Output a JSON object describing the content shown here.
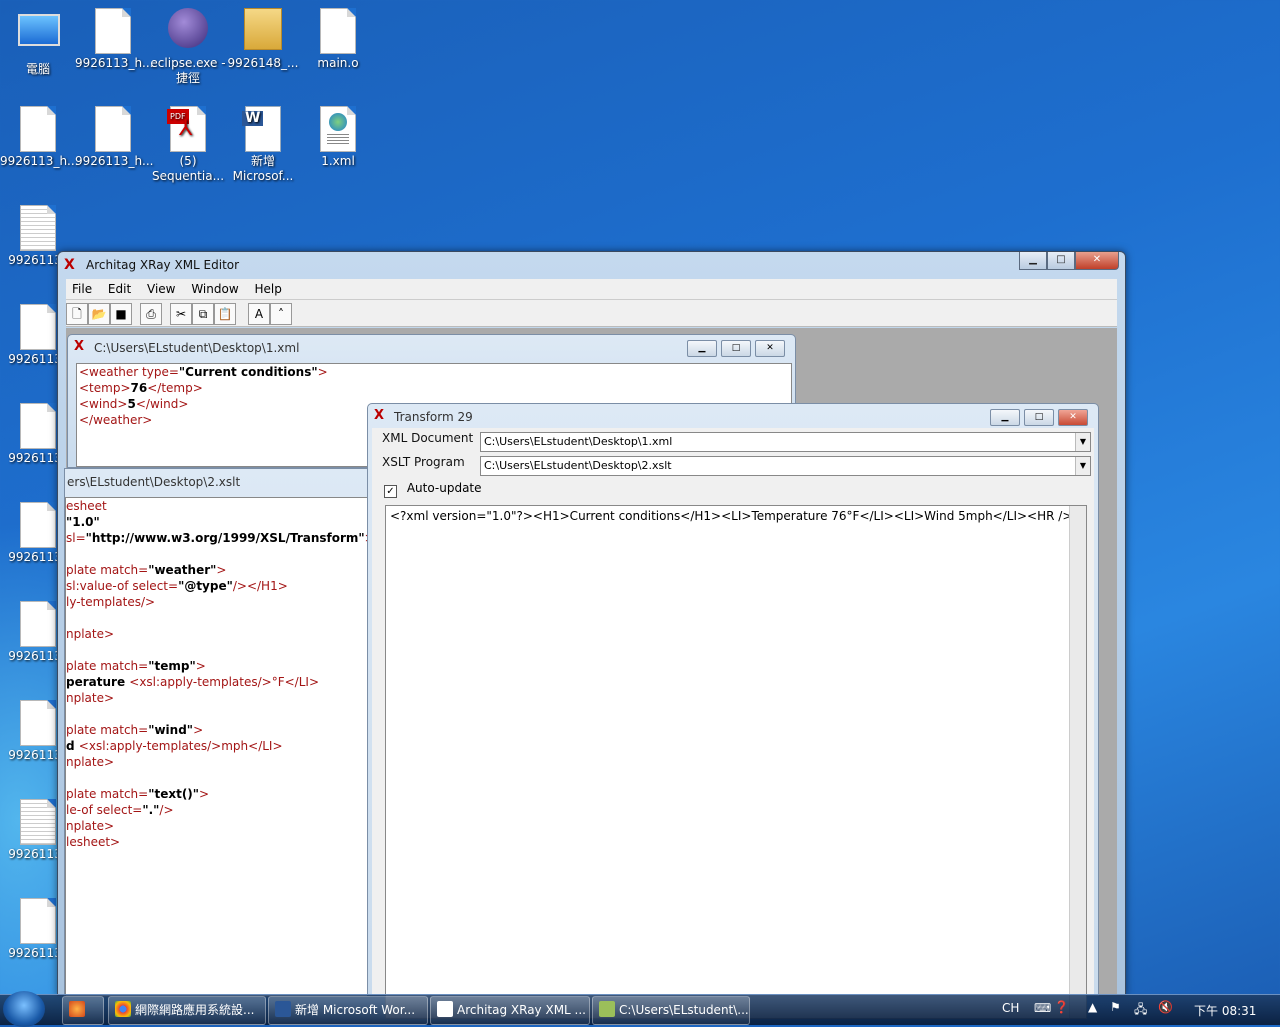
{
  "desktop": {
    "icons": [
      {
        "label": "電腦",
        "icon": "computer-icon"
      },
      {
        "label": "9926113_h...",
        "icon": "document-icon"
      },
      {
        "label": "eclipse.exe - 捷徑",
        "icon": "eclipse-icon"
      },
      {
        "label": "9926148_...",
        "icon": "folder-icon"
      },
      {
        "label": "main.o",
        "icon": "file-icon"
      },
      {
        "label": "9926113_h...",
        "icon": "file-icon"
      },
      {
        "label": "9926113_h...",
        "icon": "file-icon"
      },
      {
        "label": "(5) Sequentia...",
        "icon": "pdf-icon"
      },
      {
        "label": "新增 Microsof...",
        "icon": "word-icon"
      },
      {
        "label": "1.xml",
        "icon": "xml-icon"
      },
      {
        "label": "9926113_",
        "icon": "text-icon"
      },
      {
        "label": "9926113_",
        "icon": "file-icon"
      },
      {
        "label": "9926113_",
        "icon": "document-icon"
      },
      {
        "label": "9926113_",
        "icon": "file-icon"
      },
      {
        "label": "9926113_",
        "icon": "file-icon"
      },
      {
        "label": "9926113_",
        "icon": "file-icon"
      },
      {
        "label": "9926113_",
        "icon": "text-icon"
      },
      {
        "label": "9926113_",
        "icon": "file-icon"
      }
    ]
  },
  "app": {
    "title": "Architag XRay XML Editor",
    "menu": [
      "File",
      "Edit",
      "View",
      "Window",
      "Help"
    ],
    "toolbar": [
      "new-icon",
      "open-icon",
      "save-icon",
      "print-icon",
      "cut-icon",
      "copy-icon",
      "paste-icon",
      "font-icon",
      "format-icon"
    ]
  },
  "xml_window": {
    "title": "C:\\Users\\ELstudent\\Desktop\\1.xml",
    "lines": [
      {
        "pre": "<weather type=",
        "val": "\"Current conditions\"",
        "post": ">"
      },
      {
        "pre": "<temp>",
        "val": "76",
        "post": "</temp>"
      },
      {
        "pre": "<wind>",
        "val": "5",
        "post": "</wind>"
      },
      {
        "pre": "</weather>",
        "val": "",
        "post": ""
      }
    ]
  },
  "xslt_window": {
    "title": "ers\\ELstudent\\Desktop\\2.xslt",
    "lines": [
      {
        "pre": "esheet",
        "val": "",
        "post": ""
      },
      {
        "pre": "",
        "val": "\"1.0\"",
        "post": ""
      },
      {
        "pre": "sl=",
        "val": "\"http://www.w3.org/1999/XSL/Transform\"",
        "post": ">"
      },
      {
        "pre": "",
        "val": "",
        "post": ""
      },
      {
        "pre": "plate match=",
        "val": "\"weather\"",
        "post": ">"
      },
      {
        "pre": "sl:value-of select=",
        "val": "\"@type\"",
        "post": "/></H1>"
      },
      {
        "pre": "ly-templates/>",
        "val": "",
        "post": ""
      },
      {
        "pre": "",
        "val": "",
        "post": ""
      },
      {
        "pre": "nplate>",
        "val": "",
        "post": ""
      },
      {
        "pre": "",
        "val": "",
        "post": ""
      },
      {
        "pre": "plate match=",
        "val": "\"temp\"",
        "post": ">"
      },
      {
        "pre": "",
        "val": "perature ",
        "post": "<xsl:apply-templates/>°F</LI>"
      },
      {
        "pre": "nplate>",
        "val": "",
        "post": ""
      },
      {
        "pre": "",
        "val": "",
        "post": ""
      },
      {
        "pre": "plate match=",
        "val": "\"wind\"",
        "post": ">"
      },
      {
        "pre": "",
        "val": "d ",
        "post": "<xsl:apply-templates/>mph</LI>"
      },
      {
        "pre": "nplate>",
        "val": "",
        "post": ""
      },
      {
        "pre": "",
        "val": "",
        "post": ""
      },
      {
        "pre": "plate match=",
        "val": "\"text()\"",
        "post": ">"
      },
      {
        "pre": "le-of select=",
        "val": "\".\"",
        "post": "/>"
      },
      {
        "pre": "nplate>",
        "val": "",
        "post": ""
      },
      {
        "pre": "lesheet>",
        "val": "",
        "post": ""
      }
    ]
  },
  "transform": {
    "title": "Transform 29",
    "xml_label": "XML Document",
    "xml_value": "C:\\Users\\ELstudent\\Desktop\\1.xml",
    "xslt_label": "XSLT Program",
    "xslt_value": "C:\\Users\\ELstudent\\Desktop\\2.xslt",
    "autoupdate_label": "Auto-update",
    "autoupdate_checked": true,
    "output": "<?xml version=\"1.0\"?><H1>Current conditions</H1><LI>Temperature 76°F</LI><LI>Wind 5mph</LI><HR />"
  },
  "taskbar": {
    "buttons": [
      {
        "label": "網際網路應用系統設...",
        "icon": "chrome-icon"
      },
      {
        "label": "新增 Microsoft Wor...",
        "icon": "word-icon"
      },
      {
        "label": "Architag XRay XML ...",
        "icon": "xray-icon"
      },
      {
        "label": "C:\\Users\\ELstudent\\...",
        "icon": "notepad-icon"
      }
    ],
    "lang": "CH",
    "clock": "下午 08:31"
  }
}
